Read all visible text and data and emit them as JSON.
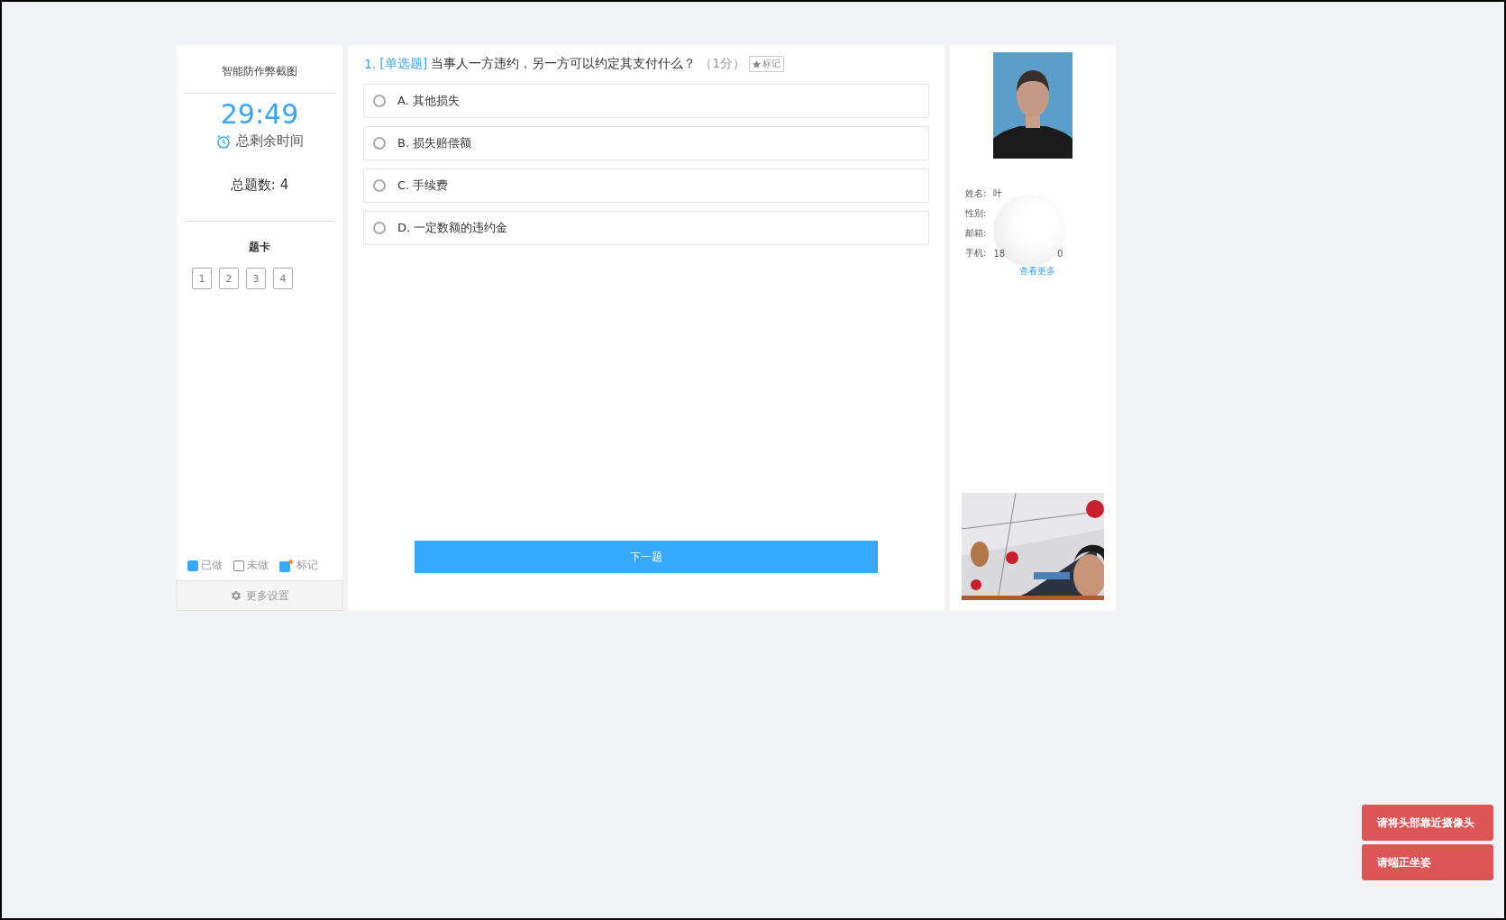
{
  "sidebar": {
    "title": "智能防作弊截图",
    "timer": "29:49",
    "timer_label": "总剩余时间",
    "total": "总题数: 4",
    "card_title": "题卡",
    "cards": [
      {
        "label": "1",
        "done": false
      },
      {
        "label": "2",
        "done": false
      },
      {
        "label": "3",
        "done": false
      },
      {
        "label": "4",
        "done": false
      }
    ],
    "legend": [
      {
        "kind": "done",
        "label": "已做"
      },
      {
        "kind": "todo",
        "label": "未做"
      },
      {
        "kind": "marked",
        "label": "标记"
      }
    ],
    "settings": "更多设置"
  },
  "question": {
    "number": "1.",
    "type": "[单选题]",
    "text": "当事人一方违约，另一方可以约定其支付什么？",
    "score": "（1分）",
    "mark_button": "标记",
    "options": [
      {
        "label": "A. 其他损失",
        "selected": false
      },
      {
        "label": "B. 损失赔偿额",
        "selected": false
      },
      {
        "label": "C. 手续费",
        "selected": false
      },
      {
        "label": "D. 一定数额的违约金",
        "selected": false
      }
    ],
    "next_button": "下一题"
  },
  "profile": {
    "fields": [
      {
        "label": "姓名:",
        "value": "叶"
      },
      {
        "label": "性别:"
      },
      {
        "label": "邮箱:"
      },
      {
        "label": "手机:",
        "value": "18",
        "value_end": "0"
      }
    ],
    "more_link": "查看更多"
  },
  "alerts": [
    "请将头部靠近摄像头",
    "请端正坐姿"
  ]
}
